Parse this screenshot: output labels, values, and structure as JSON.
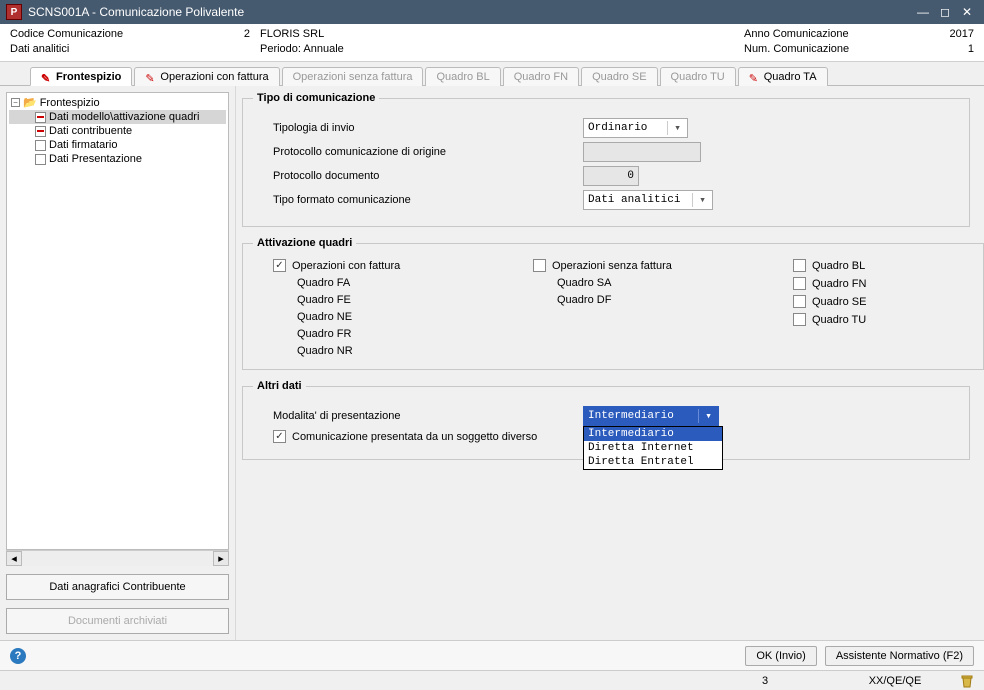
{
  "title": "SCNS001A - Comunicazione Polivalente",
  "header": {
    "codice_label": "Codice Comunicazione",
    "codice_value": "2",
    "company": "FLORIS SRL",
    "anno_label": "Anno Comunicazione",
    "anno_value": "2017",
    "dati_label": "Dati analitici",
    "periodo_label": "Periodo: Annuale",
    "num_label": "Num. Comunicazione",
    "num_value": "1"
  },
  "tabs": [
    {
      "label": "Frontespizio",
      "active": true,
      "enabled": true
    },
    {
      "label": "Operazioni con fattura",
      "active": false,
      "enabled": true
    },
    {
      "label": "Operazioni senza fattura",
      "active": false,
      "enabled": false
    },
    {
      "label": "Quadro BL",
      "active": false,
      "enabled": false
    },
    {
      "label": "Quadro FN",
      "active": false,
      "enabled": false
    },
    {
      "label": "Quadro SE",
      "active": false,
      "enabled": false
    },
    {
      "label": "Quadro TU",
      "active": false,
      "enabled": false
    },
    {
      "label": "Quadro TA",
      "active": false,
      "enabled": true
    }
  ],
  "tree": {
    "root": "Frontespizio",
    "children": [
      "Dati modello\\attivazione quadri",
      "Dati contribuente",
      "Dati firmatario",
      "Dati Presentazione"
    ],
    "selected_index": 0
  },
  "left_buttons": {
    "anagrafica": "Dati anagrafici Contribuente",
    "documenti": "Documenti archiviati"
  },
  "group_tipo": {
    "legend": "Tipo di comunicazione",
    "tipologia_label": "Tipologia di invio",
    "tipologia_value": "Ordinario",
    "protocollo_orig_label": "Protocollo comunicazione di origine",
    "protocollo_orig_value": "",
    "protocollo_doc_label": "Protocollo documento",
    "protocollo_doc_value": "0",
    "formato_label": "Tipo formato comunicazione",
    "formato_value": "Dati analitici"
  },
  "group_att": {
    "legend": "Attivazione quadri",
    "col1": {
      "head": "Operazioni con fattura",
      "items": [
        "Quadro FA",
        "Quadro FE",
        "Quadro NE",
        "Quadro FR",
        "Quadro NR"
      ],
      "checked": true
    },
    "col2": {
      "head": "Operazioni senza fattura",
      "items": [
        "Quadro SA",
        "Quadro DF"
      ],
      "checked": false
    },
    "col3": {
      "items": [
        {
          "label": "Quadro BL",
          "checked": false
        },
        {
          "label": "Quadro FN",
          "checked": false
        },
        {
          "label": "Quadro SE",
          "checked": false
        },
        {
          "label": "Quadro TU",
          "checked": false
        }
      ]
    }
  },
  "group_altri": {
    "legend": "Altri dati",
    "modalita_label": "Modalita' di presentazione",
    "modalita_selected": "Intermediario",
    "modalita_options": [
      "Intermediario",
      "Diretta Internet",
      "Diretta Entratel"
    ],
    "diverso_label": "Comunicazione presentata da un soggetto diverso",
    "diverso_checked": true
  },
  "footer": {
    "ok": "OK (Invio)",
    "assist": "Assistente Normativo (F2)"
  },
  "statusbar": {
    "seg1": "3",
    "seg2": "XX/QE/QE"
  }
}
